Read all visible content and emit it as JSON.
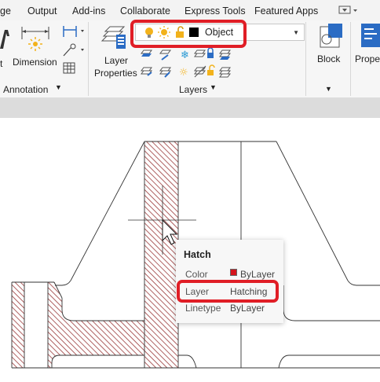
{
  "ribbon_tabs": [
    "ge",
    "Output",
    "Add-ins",
    "Collaborate",
    "Express Tools",
    "Featured Apps"
  ],
  "annotation_panel": {
    "text_partial": "t",
    "dimension_label": "Dimension",
    "panel_label": "Annotation"
  },
  "layers_panel": {
    "layer_properties_line1": "Layer",
    "layer_properties_line2": "Properties",
    "current_layer": "Object",
    "panel_label": "Layers"
  },
  "block_panel": {
    "label": "Block"
  },
  "properties_panel": {
    "label": "Prope"
  },
  "tooltip": {
    "title": "Hatch",
    "rows": [
      {
        "key": "Color",
        "value": "ByLayer"
      },
      {
        "key": "Layer",
        "value": "Hatching"
      },
      {
        "key": "Linetype",
        "value": "ByLayer"
      }
    ]
  },
  "colors": {
    "highlight": "#e01e26",
    "hatch": "#9b3a3a",
    "layer_color_swatch": "#000000",
    "bylayer_swatch": "#d4131b"
  }
}
